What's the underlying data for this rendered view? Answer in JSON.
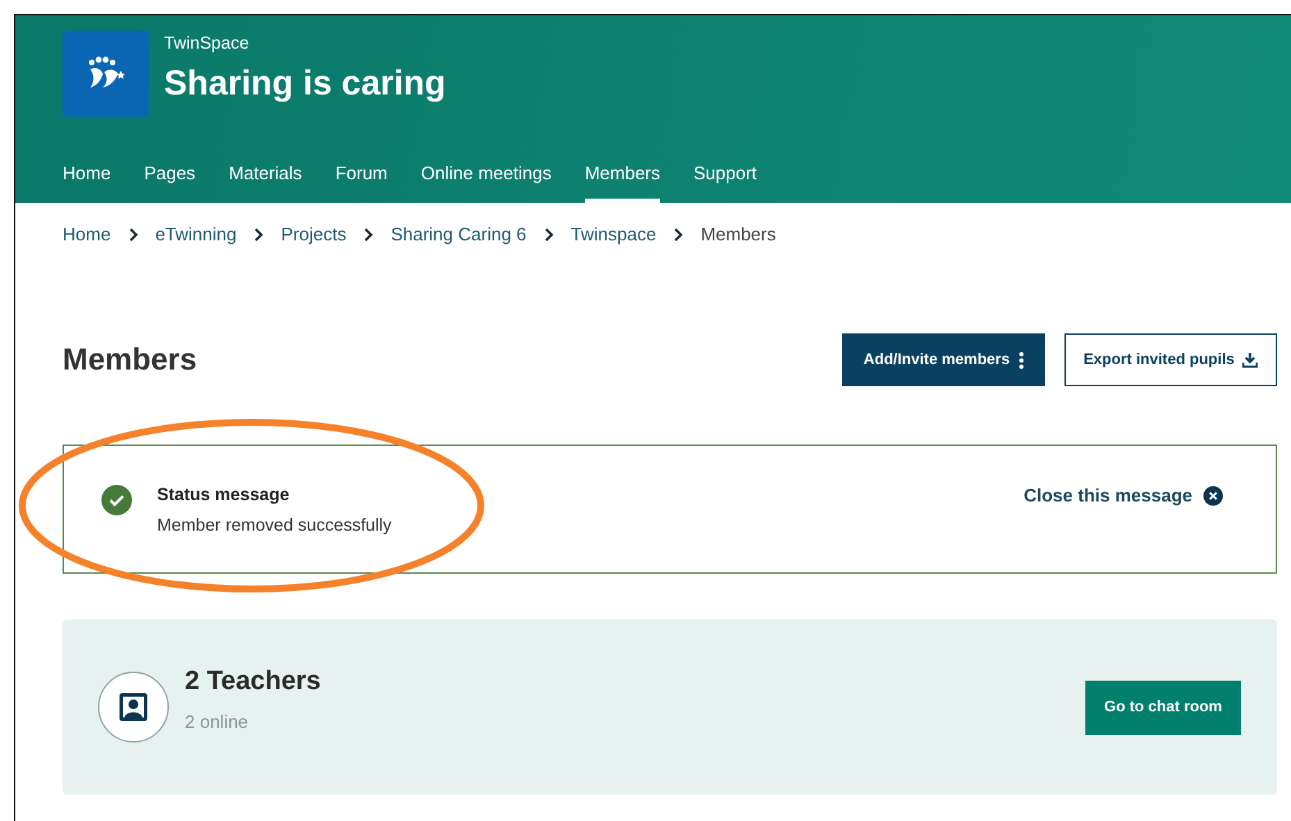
{
  "header": {
    "site": "TwinSpace",
    "title": "Sharing is caring",
    "nav": [
      {
        "label": "Home",
        "selected": false
      },
      {
        "label": "Pages",
        "selected": false
      },
      {
        "label": "Materials",
        "selected": false
      },
      {
        "label": "Forum",
        "selected": false
      },
      {
        "label": "Online meetings",
        "selected": false
      },
      {
        "label": "Members",
        "selected": true
      },
      {
        "label": "Support",
        "selected": false
      }
    ]
  },
  "breadcrumb": [
    {
      "label": "Home",
      "current": false
    },
    {
      "label": "eTwinning",
      "current": false
    },
    {
      "label": "Projects",
      "current": false
    },
    {
      "label": "Sharing Caring 6",
      "current": false
    },
    {
      "label": "Twinspace",
      "current": false
    },
    {
      "label": "Members",
      "current": true
    }
  ],
  "page": {
    "title": "Members",
    "buttons": [
      {
        "label": "Add/Invite members",
        "kind": "primary"
      },
      {
        "label": "Export invited pupils",
        "kind": "secondary"
      }
    ]
  },
  "status": {
    "title": "Status message",
    "text": "Member removed successfully",
    "close": "Close this message"
  },
  "groups": [
    {
      "title": "2 Teachers",
      "online": "2 online",
      "action": "Go to chat room"
    }
  ]
}
